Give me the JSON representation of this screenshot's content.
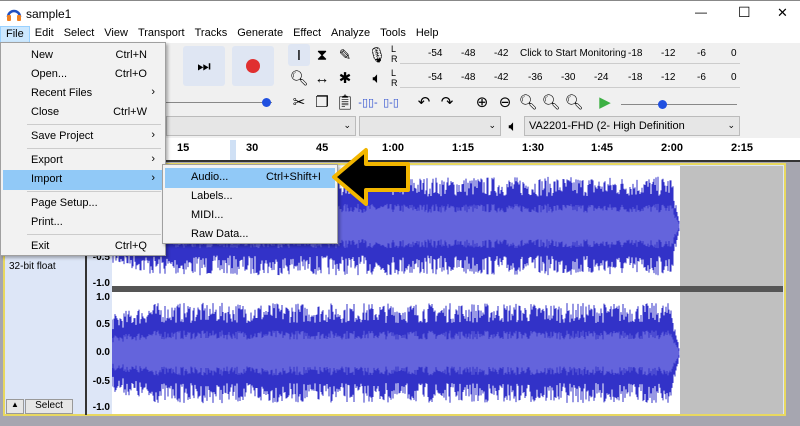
{
  "window": {
    "title": "sample1",
    "minimize": "—",
    "maximize": "☐",
    "close": "✕"
  },
  "menubar": [
    "File",
    "Edit",
    "Select",
    "View",
    "Transport",
    "Tracks",
    "Generate",
    "Effect",
    "Analyze",
    "Tools",
    "Help"
  ],
  "file_menu": {
    "items": [
      {
        "label": "New",
        "shortcut": "Ctrl+N"
      },
      {
        "label": "Open...",
        "shortcut": "Ctrl+O"
      },
      {
        "label": "Recent Files",
        "submenu": true
      },
      {
        "label": "Close",
        "shortcut": "Ctrl+W"
      },
      {
        "label": "Save Project",
        "submenu": true
      },
      {
        "label": "Export",
        "submenu": true
      },
      {
        "label": "Import",
        "submenu": true,
        "highlighted": true
      },
      {
        "label": "Page Setup..."
      },
      {
        "label": "Print..."
      },
      {
        "label": "Exit",
        "shortcut": "Ctrl+Q"
      }
    ]
  },
  "import_submenu": {
    "items": [
      {
        "label": "Audio...",
        "shortcut": "Ctrl+Shift+I",
        "highlighted": true
      },
      {
        "label": "Labels..."
      },
      {
        "label": "MIDI..."
      },
      {
        "label": "Raw Data..."
      }
    ]
  },
  "meters": {
    "record": {
      "channels": [
        "L",
        "R"
      ],
      "ticks": [
        "-54",
        "-48",
        "-42",
        "-18",
        "-12",
        "-6",
        "0"
      ],
      "prompt": "Click to Start Monitoring"
    },
    "playback": {
      "channels": [
        "L",
        "R"
      ],
      "ticks": [
        "-54",
        "-48",
        "-42",
        "-36",
        "-30",
        "-24",
        "-18",
        "-12",
        "-6",
        "0"
      ]
    }
  },
  "device": {
    "playback_device": "VA2201-FHD (2- High Definition"
  },
  "playback_speed_fraction": 0.35,
  "timeline": {
    "ticks": [
      "15",
      "30",
      "45",
      "1:00",
      "1:15",
      "1:30",
      "1:45",
      "2:00",
      "2:15"
    ]
  },
  "track": {
    "format": "32-bit float",
    "select_label": "Select",
    "scale": [
      "1.0",
      "0.5",
      "0.0",
      "-0.5",
      "-1.0"
    ],
    "scale_partial": [
      "-0.5",
      "-1.0"
    ]
  },
  "colors": {
    "wave": "#3232c8",
    "wave_rms": "#6464dc",
    "highlight": "#91c9f7",
    "arrow": "#000000",
    "arrow_outline": "#f2b600",
    "record": "#e03030",
    "play": "#3cb043"
  }
}
